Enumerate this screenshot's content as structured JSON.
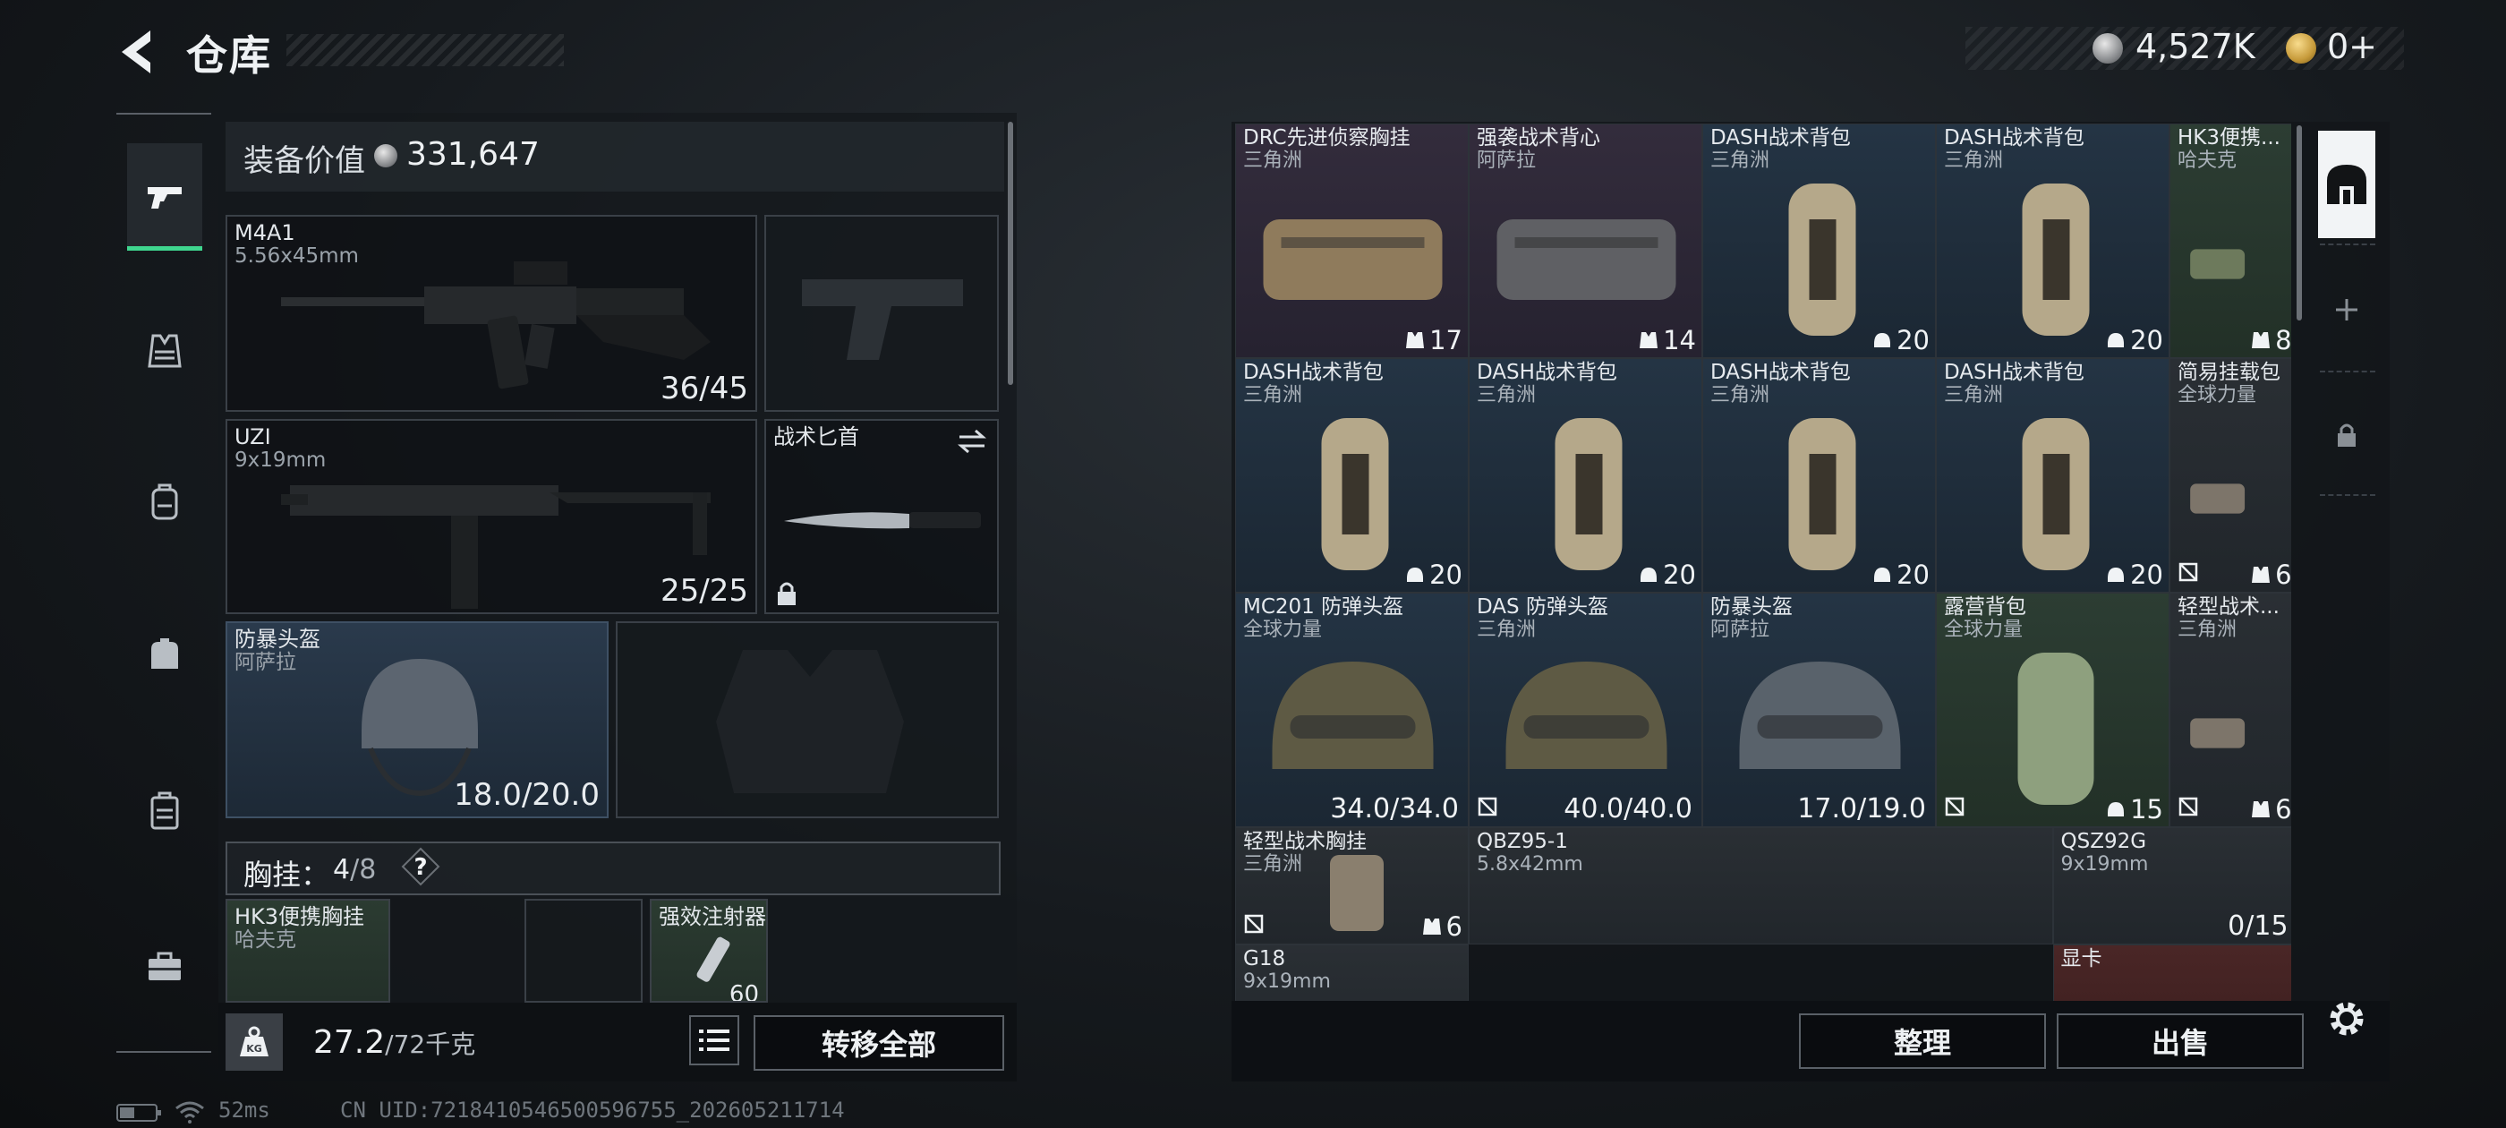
{
  "header": {
    "title": "仓库",
    "currencies": [
      {
        "icon": "silver-coin-icon",
        "value": "4,527K"
      },
      {
        "icon": "gold-coin-icon",
        "value": "0+"
      }
    ]
  },
  "nav": {
    "items": [
      {
        "name": "weapons",
        "icon": "pistol-icon",
        "active": true
      },
      {
        "name": "armor",
        "icon": "vest-icon"
      },
      {
        "name": "backpack",
        "icon": "backpack-icon"
      },
      {
        "name": "pouch",
        "icon": "pouch-icon"
      },
      {
        "name": "container",
        "icon": "case-icon"
      },
      {
        "name": "toolbox",
        "icon": "toolbox-icon"
      }
    ]
  },
  "loadout": {
    "value_label": "装备价值",
    "value": "331,647",
    "primary": {
      "name": "M4A1",
      "caliber": "5.56x45mm",
      "ammo": "36/45"
    },
    "secondary": {
      "name": "UZI",
      "caliber": "9x19mm",
      "ammo": "25/25"
    },
    "melee": {
      "name": "战术匕首"
    },
    "helmet": {
      "name": "防暴头盔",
      "brand": "阿萨拉",
      "durability": "18.0/20.0"
    },
    "chest_rig": {
      "label": "胸挂：",
      "count": "4",
      "max": "/8"
    },
    "rig_items": [
      {
        "name": "HK3便携胸挂",
        "brand": "哈夫克"
      },
      {
        "name": ""
      },
      {
        "name": "强效注射器",
        "value": "60"
      }
    ],
    "weight": {
      "value": "27.2",
      "max": "/72千克"
    },
    "transfer_label": "转移全部"
  },
  "stash": {
    "items": [
      {
        "name": "DRC先进侦察胸挂",
        "brand": "三角洲",
        "badge": "17",
        "badge_icon": "vest-icon",
        "color": "purple"
      },
      {
        "name": "强袭战术背心",
        "brand": "阿萨拉",
        "badge": "14",
        "badge_icon": "vest-icon",
        "color": "purple"
      },
      {
        "name": "DASH战术背包",
        "brand": "三角洲",
        "badge": "20",
        "badge_icon": "helmet-icon",
        "color": "blue"
      },
      {
        "name": "DASH战术背包",
        "brand": "三角洲",
        "badge": "20",
        "badge_icon": "helmet-icon",
        "color": "blue"
      },
      {
        "name": "HK3便携...",
        "brand": "哈夫克",
        "badge": "8",
        "badge_icon": "vest-icon",
        "color": "green"
      },
      {
        "name": "DASH战术背包",
        "brand": "三角洲",
        "badge": "20",
        "badge_icon": "helmet-icon",
        "color": "blue"
      },
      {
        "name": "DASH战术背包",
        "brand": "三角洲",
        "badge": "20",
        "badge_icon": "helmet-icon",
        "color": "blue"
      },
      {
        "name": "DASH战术背包",
        "brand": "三角洲",
        "badge": "20",
        "badge_icon": "helmet-icon",
        "color": "blue"
      },
      {
        "name": "DASH战术背包",
        "brand": "三角洲",
        "badge": "20",
        "badge_icon": "helmet-icon",
        "color": "blue"
      },
      {
        "name": "简易挂载包",
        "brand": "全球力量",
        "badge": "6",
        "badge_icon": "vest-icon",
        "color": "gray"
      },
      {
        "name": "MC201 防弹头盔",
        "brand": "全球力量",
        "value": "34.0/34.0",
        "color": "blue"
      },
      {
        "name": "DAS 防弹头盔",
        "brand": "三角洲",
        "value": "40.0/40.0",
        "color": "blue"
      },
      {
        "name": "防暴头盔",
        "brand": "阿萨拉",
        "value": "17.0/19.0",
        "color": "blue"
      },
      {
        "name": "露营背包",
        "brand": "全球力量",
        "badge": "15",
        "badge_icon": "helmet-icon",
        "color": "green"
      },
      {
        "name": "轻型战术...",
        "brand": "三角洲",
        "badge": "6",
        "badge_icon": "vest-icon",
        "color": "gray"
      },
      {
        "name": "轻型战术胸挂",
        "brand": "三角洲",
        "badge": "6",
        "badge_icon": "vest-icon",
        "color": "gray"
      },
      {
        "name": "QBZ95-1",
        "brand": "5.8x42mm",
        "color": "gray"
      },
      {
        "name": "QSZ92G",
        "brand": "9x19mm",
        "value": "0/15",
        "color": "gray"
      },
      {
        "name": "G18",
        "brand": "9x19mm",
        "color": "gray"
      },
      {
        "name": "显卡",
        "brand": "",
        "color": "red"
      }
    ],
    "sort_label": "整理",
    "sell_label": "出售"
  },
  "side_tabs": [
    {
      "icon": "stash-icon",
      "active": true
    },
    {
      "icon": "plus-icon"
    },
    {
      "icon": "lock-icon"
    }
  ],
  "status": {
    "ping": "52ms",
    "uid": "CN UID:7218410546500596755_202605211714"
  }
}
